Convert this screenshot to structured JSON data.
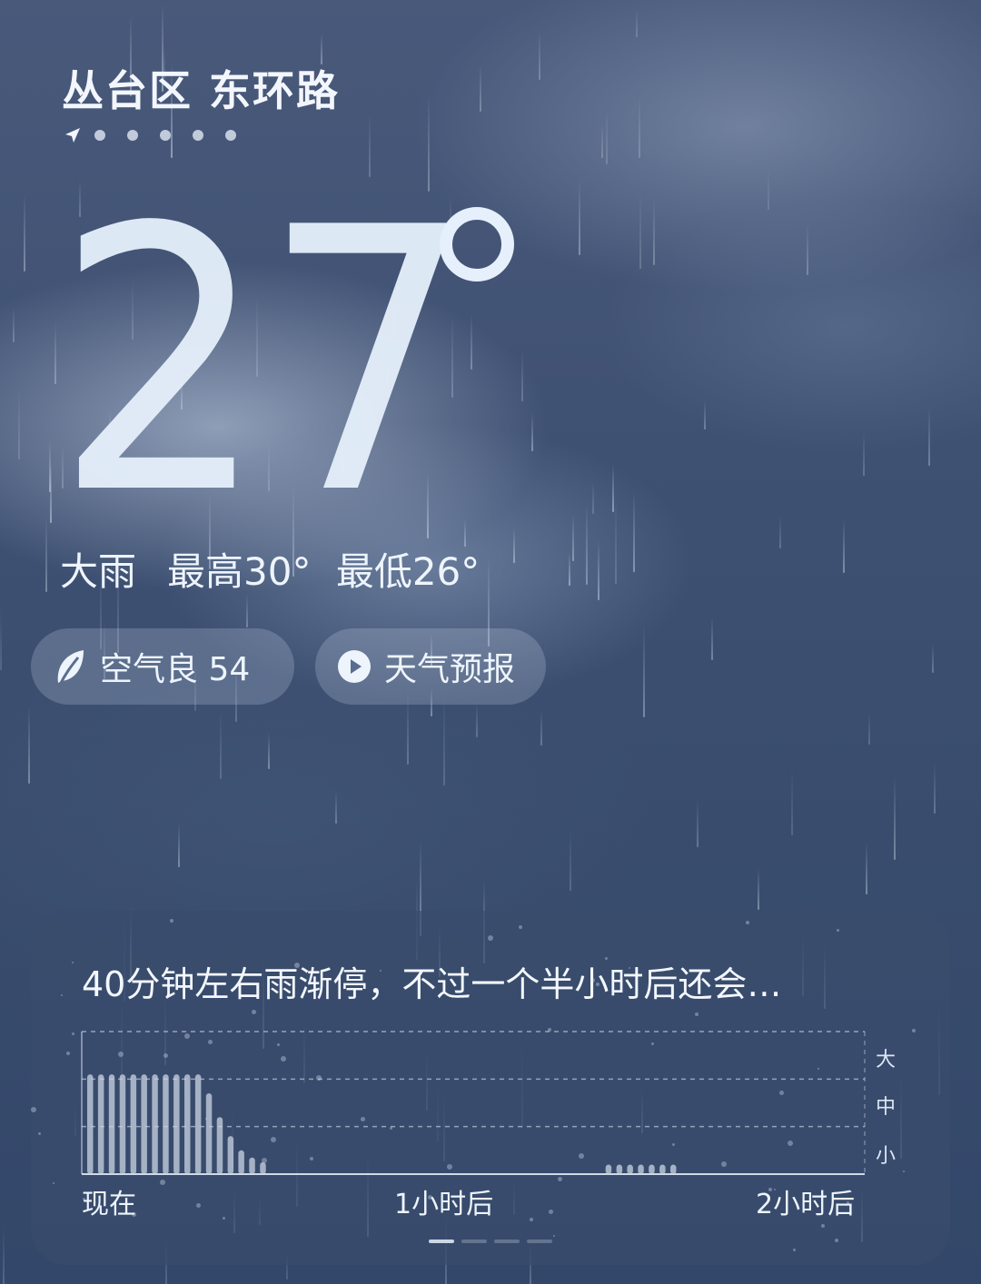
{
  "location": {
    "name": "丛台区 东环路"
  },
  "pager": {
    "current_icon": "navigation-arrow-icon",
    "dot_count": 5
  },
  "current": {
    "temperature": "27",
    "condition": "大雨",
    "high": "最高30°",
    "low": "最低26°"
  },
  "pills": {
    "aqi": {
      "icon": "leaf-icon",
      "label": "空气良 54"
    },
    "forecast": {
      "icon": "play-circle-icon",
      "label": "天气预报"
    }
  },
  "precip_card": {
    "summary": "40分钟左右雨渐停，不过一个半小时后还会…",
    "x_labels": [
      "现在",
      "1小时后",
      "2小时后"
    ],
    "intensity_labels": [
      "大",
      "中",
      "小"
    ],
    "page_count": 4,
    "active_page": 0
  },
  "chart_data": {
    "type": "bar",
    "xlabel": "",
    "ylabel": "",
    "x_ticks": [
      "现在",
      "1小时后",
      "2小时后"
    ],
    "y_levels": [
      "小",
      "中",
      "大"
    ],
    "ylim": [
      0,
      3
    ],
    "values": [
      2.1,
      2.1,
      2.1,
      2.1,
      2.1,
      2.1,
      2.1,
      2.1,
      2.1,
      2.1,
      2.1,
      1.7,
      1.2,
      0.8,
      0.5,
      0.35,
      0.25,
      0,
      0,
      0,
      0,
      0,
      0,
      0,
      0,
      0,
      0,
      0,
      0,
      0,
      0,
      0,
      0,
      0,
      0,
      0,
      0,
      0,
      0,
      0,
      0,
      0,
      0,
      0,
      0,
      0,
      0,
      0,
      0.2,
      0.2,
      0.2,
      0.2,
      0.2,
      0.2,
      0.2,
      0,
      0,
      0,
      0,
      0,
      0,
      0,
      0,
      0,
      0,
      0,
      0,
      0,
      0,
      0,
      0,
      0
    ],
    "bar_color": "#c9d3e2",
    "grid": true
  }
}
